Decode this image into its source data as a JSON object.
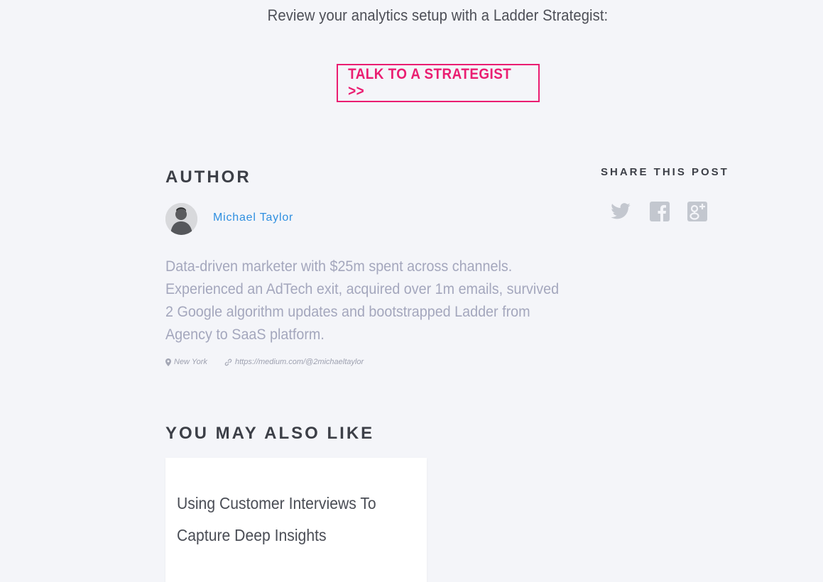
{
  "review_text": "Review your analytics setup with a Ladder Strategist:",
  "cta_label": "TALK TO A STRATEGIST >>",
  "author": {
    "heading": "AUTHOR",
    "name": "Michael Taylor",
    "bio": "Data-driven marketer with $25m spent across channels. Experienced an AdTech exit, acquired over 1m emails, survived 2 Google algorithm updates and bootstrapped Ladder from Agency to SaaS platform.",
    "location": "New York",
    "link": "https://medium.com/@2michaeltaylor"
  },
  "share": {
    "heading": "SHARE THIS POST",
    "icons": [
      "twitter-icon",
      "facebook-icon",
      "google-plus-icon"
    ]
  },
  "also_like": {
    "heading": "YOU MAY ALSO LIKE",
    "cards": [
      {
        "title": "Using Customer Interviews To Capture Deep Insights"
      }
    ]
  },
  "colors": {
    "accent": "#ea1d71",
    "link": "#2f8fe0",
    "icon": "#c3c7cf",
    "background": "#f4f5f9"
  }
}
